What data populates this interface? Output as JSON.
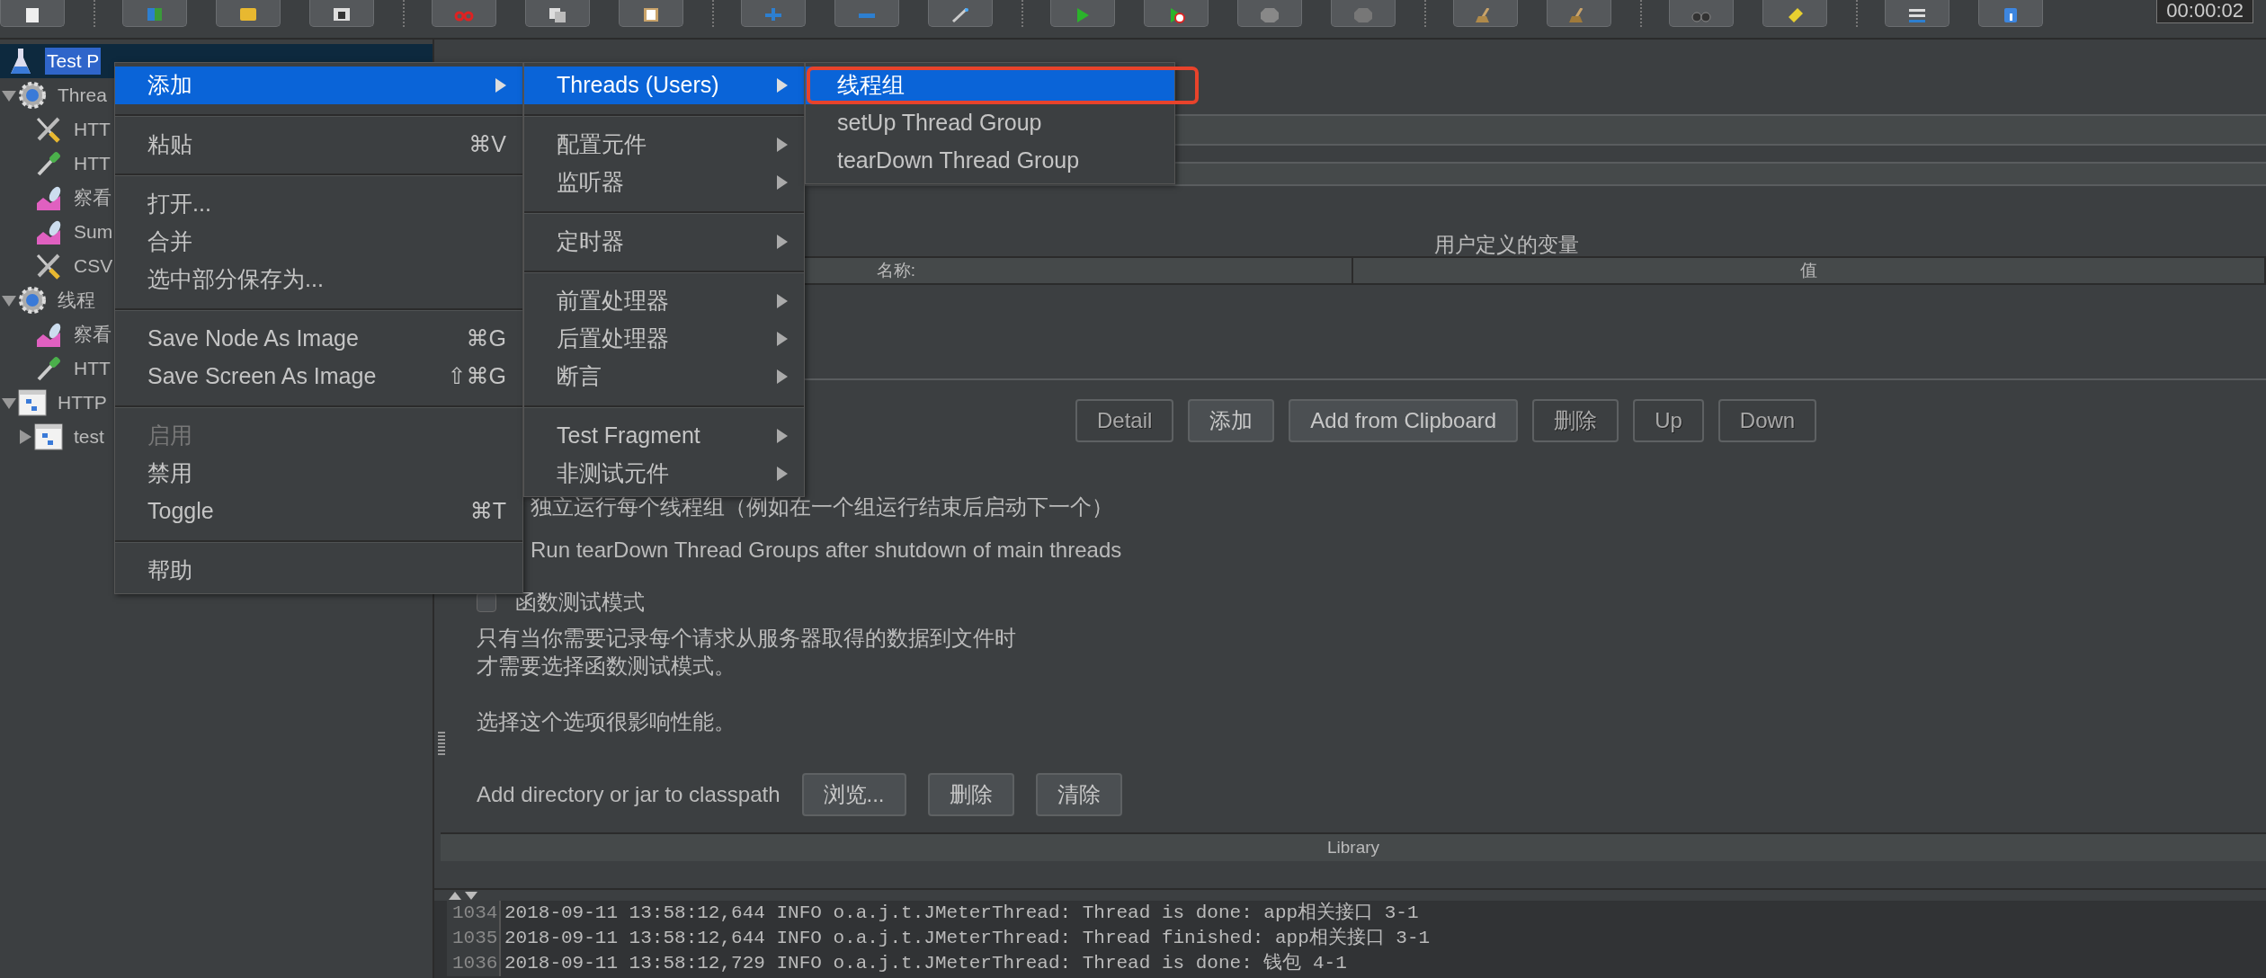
{
  "toolbar": {
    "timer": "00:00:02"
  },
  "tree": [
    {
      "label": "Test P",
      "kind": "test-plan",
      "selected": true,
      "children": [
        {
          "label": "Threa",
          "kind": "thread-group",
          "selected": false,
          "expanded": true,
          "children": [
            {
              "label": "HTT",
              "kind": "config",
              "selected": false
            },
            {
              "label": "HTT",
              "kind": "pipette",
              "selected": false
            },
            {
              "label": "察看",
              "kind": "listener",
              "selected": false
            },
            {
              "label": "Sum",
              "kind": "listener",
              "selected": false
            },
            {
              "label": "CSV",
              "kind": "config",
              "selected": false
            }
          ]
        },
        {
          "label": "线程",
          "kind": "thread-group",
          "selected": false,
          "expanded": true,
          "children": [
            {
              "label": "察看",
              "kind": "listener",
              "selected": false
            },
            {
              "label": "HTT",
              "kind": "pipette",
              "selected": false
            }
          ]
        },
        {
          "label": "HTTP",
          "kind": "controller",
          "selected": false,
          "expanded": true,
          "children": [
            {
              "label": "test",
              "kind": "controller",
              "selected": false,
              "expanded": false
            }
          ]
        }
      ]
    }
  ],
  "context_menu": [
    {
      "kind": "item",
      "label": "添加",
      "selected": true,
      "disabled": false,
      "submenu": true
    },
    {
      "kind": "separator"
    },
    {
      "kind": "item",
      "label": "粘贴",
      "shortcut": "⌘V",
      "selected": false,
      "disabled": false,
      "submenu": false
    },
    {
      "kind": "separator"
    },
    {
      "kind": "item",
      "label": "打开...",
      "selected": false,
      "disabled": false,
      "submenu": false
    },
    {
      "kind": "item",
      "label": "合并",
      "selected": false,
      "disabled": false,
      "submenu": false
    },
    {
      "kind": "item",
      "label": "选中部分保存为...",
      "selected": false,
      "disabled": false,
      "submenu": false
    },
    {
      "kind": "separator"
    },
    {
      "kind": "item",
      "label": "Save Node As Image",
      "shortcut": "⌘G",
      "selected": false,
      "disabled": false,
      "submenu": false
    },
    {
      "kind": "item",
      "label": "Save Screen As Image",
      "shortcut": "⇧⌘G",
      "selected": false,
      "disabled": false,
      "submenu": false
    },
    {
      "kind": "separator"
    },
    {
      "kind": "item",
      "label": "启用",
      "selected": false,
      "disabled": true,
      "submenu": false
    },
    {
      "kind": "item",
      "label": "禁用",
      "selected": false,
      "disabled": false,
      "submenu": false
    },
    {
      "kind": "item",
      "label": "Toggle",
      "shortcut": "⌘T",
      "selected": false,
      "disabled": false,
      "submenu": false
    },
    {
      "kind": "separator"
    },
    {
      "kind": "item",
      "label": "帮助",
      "selected": false,
      "disabled": false,
      "submenu": false
    }
  ],
  "add_submenu": [
    {
      "kind": "item",
      "label": "Threads (Users)",
      "selected": true,
      "disabled": false,
      "submenu": true
    },
    {
      "kind": "separator"
    },
    {
      "kind": "item",
      "label": "配置元件",
      "selected": false,
      "disabled": false,
      "submenu": true
    },
    {
      "kind": "item",
      "label": "监听器",
      "selected": false,
      "disabled": false,
      "submenu": true
    },
    {
      "kind": "separator"
    },
    {
      "kind": "item",
      "label": "定时器",
      "selected": false,
      "disabled": false,
      "submenu": true
    },
    {
      "kind": "separator"
    },
    {
      "kind": "item",
      "label": "前置处理器",
      "selected": false,
      "disabled": false,
      "submenu": true
    },
    {
      "kind": "item",
      "label": "后置处理器",
      "selected": false,
      "disabled": false,
      "submenu": true
    },
    {
      "kind": "item",
      "label": "断言",
      "selected": false,
      "disabled": false,
      "submenu": true
    },
    {
      "kind": "separator"
    },
    {
      "kind": "item",
      "label": "Test Fragment",
      "selected": false,
      "disabled": false,
      "submenu": true
    },
    {
      "kind": "item",
      "label": "非测试元件",
      "selected": false,
      "disabled": false,
      "submenu": true
    }
  ],
  "threads_submenu": [
    {
      "label": "线程组",
      "selected": true,
      "highlighted": true
    },
    {
      "label": "setUp Thread Group",
      "selected": false,
      "highlighted": false
    },
    {
      "label": "tearDown Thread Group",
      "selected": false,
      "highlighted": false
    }
  ],
  "variables": {
    "title": "用户定义的变量",
    "columns": [
      "名称:",
      "值"
    ]
  },
  "variable_buttons": [
    {
      "label": "Detail",
      "disabled": true
    },
    {
      "label": "添加",
      "disabled": false
    },
    {
      "label": "Add from Clipboard",
      "disabled": false
    },
    {
      "label": "删除",
      "disabled": true
    },
    {
      "label": "Up",
      "disabled": true
    },
    {
      "label": "Down",
      "disabled": true
    }
  ],
  "options": [
    {
      "label": "独立运行每个线程组（例如在一个组运行结束后启动下一个）"
    },
    {
      "label": "Run tearDown Thread Groups after shutdown of main threads"
    },
    {
      "label": "函数测试模式",
      "checked": false
    }
  ],
  "notes": [
    [
      "只有当你需要记录每个请求从服务器取得的数据到文件时",
      "才需要选择函数测试模式。"
    ],
    [
      "选择这个选项很影响性能。"
    ]
  ],
  "classpath": {
    "label": "Add directory or jar to classpath",
    "buttons": [
      "浏览...",
      "删除",
      "清除"
    ],
    "columns": [
      "Library"
    ]
  },
  "log": [
    {
      "number": "1034",
      "text": "2018-09-11 13:58:12,644 INFO o.a.j.t.JMeterThread: Thread is done: app相关接口 3-1"
    },
    {
      "number": "1035",
      "text": "2018-09-11 13:58:12,644 INFO o.a.j.t.JMeterThread: Thread finished: app相关接口 3-1"
    },
    {
      "number": "1036",
      "text": "2018-09-11 13:58:12,729 INFO o.a.j.t.JMeterThread: Thread is done: 钱包 4-1"
    }
  ]
}
